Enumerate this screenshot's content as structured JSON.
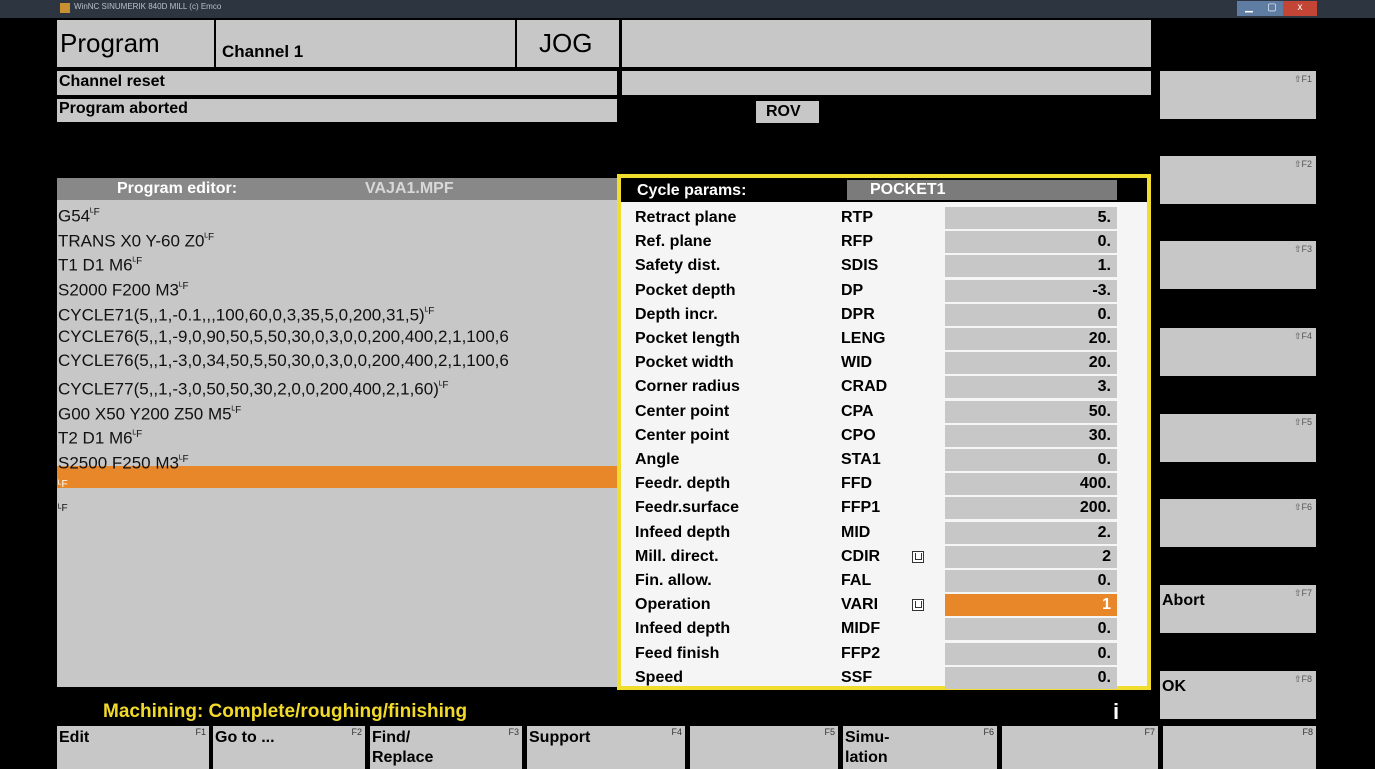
{
  "window": {
    "title": "WinNC SINUMERIK 840D MILL (c) Emco",
    "min_glyph": "▁",
    "max_glyph": "▢",
    "close_glyph": "x"
  },
  "header": {
    "area": "Program",
    "channel": "Channel 1",
    "mode": "JOG",
    "channel_status": "Channel reset",
    "program_status": "Program aborted",
    "rov": "ROV"
  },
  "editor": {
    "title": "Program editor:",
    "filename": "VAJA1.MPF",
    "lf_symbol": "ᴸF",
    "lines": [
      {
        "text": "G54",
        "lf": true
      },
      {
        "text": "TRANS X0 Y-60 Z0",
        "lf": true
      },
      {
        "text": "T1 D1 M6",
        "lf": true
      },
      {
        "text": "S2000 F200 M3",
        "lf": true
      },
      {
        "text": "CYCLE71(5,,1,-0.1,,,100,60,0,3,35,5,0,200,31,5)",
        "lf": true
      },
      {
        "text": "CYCLE76(5,,1,-9,0,90,50,5,50,30,0,3,0,0,200,400,2,1,100,6",
        "lf": false
      },
      {
        "text": "CYCLE76(5,,1,-3,0,34,50,5,50,30,0,3,0,0,200,400,2,1,100,6",
        "lf": false
      },
      {
        "text": "CYCLE77(5,,1,-3,0,50,50,30,2,0,0,200,400,2,1,60)",
        "lf": true
      },
      {
        "text": "G00 X50 Y200 Z50 M5",
        "lf": true
      },
      {
        "text": "T2 D1 M6",
        "lf": true
      },
      {
        "text": "S2500 F250 M3",
        "lf": true
      },
      {
        "text": "",
        "lf": true
      },
      {
        "text": "",
        "lf": true
      }
    ],
    "cursor_line_index": 11,
    "cursor_color": "#e8872a"
  },
  "cycle": {
    "title": "Cycle params:",
    "name": "POCKET1",
    "border_color": "#f1dd2e",
    "params": [
      {
        "label": "Retract plane",
        "name": "RTP",
        "value": "5."
      },
      {
        "label": "Ref. plane",
        "name": "RFP",
        "value": "0."
      },
      {
        "label": "Safety dist.",
        "name": "SDIS",
        "value": "1."
      },
      {
        "label": "Pocket depth",
        "name": "DP",
        "value": "-3."
      },
      {
        "label": "Depth incr.",
        "name": "DPR",
        "value": "0."
      },
      {
        "label": "Pocket length",
        "name": "LENG",
        "value": "20."
      },
      {
        "label": "Pocket width",
        "name": "WID",
        "value": "20."
      },
      {
        "label": "Corner radius",
        "name": "CRAD",
        "value": "3."
      },
      {
        "label": "Center point",
        "name": "CPA",
        "value": "50."
      },
      {
        "label": "Center point",
        "name": "CPO",
        "value": "30."
      },
      {
        "label": "Angle",
        "name": "STA1",
        "value": "0."
      },
      {
        "label": "Feedr. depth",
        "name": "FFD",
        "value": "400."
      },
      {
        "label": "Feedr.surface",
        "name": "FFP1",
        "value": "200."
      },
      {
        "label": "Infeed depth",
        "name": "MID",
        "value": "2."
      },
      {
        "label": "Mill. direct.",
        "name": "CDIR",
        "value": "2",
        "toggle": true
      },
      {
        "label": "Fin. allow.",
        "name": "FAL",
        "value": "0."
      },
      {
        "label": "Operation",
        "name": "VARI",
        "value": "1",
        "toggle": true,
        "selected": true
      },
      {
        "label": "Infeed depth",
        "name": "MIDF",
        "value": "0."
      },
      {
        "label": "Feed finish",
        "name": "FFP2",
        "value": "0."
      },
      {
        "label": "Speed",
        "name": "SSF",
        "value": "0."
      }
    ]
  },
  "vertical_softkeys": [
    {
      "key": "⇧F1",
      "label": ""
    },
    {
      "key": "⇧F2",
      "label": ""
    },
    {
      "key": "⇧F3",
      "label": ""
    },
    {
      "key": "⇧F4",
      "label": ""
    },
    {
      "key": "⇧F5",
      "label": ""
    },
    {
      "key": "⇧F6",
      "label": ""
    },
    {
      "key": "⇧F7",
      "label": "Abort"
    },
    {
      "key": "⇧F8",
      "label": "OK"
    }
  ],
  "message": "Machining: Complete/roughing/finishing",
  "info_glyph": "i",
  "horizontal_softkeys": [
    {
      "key": "F1",
      "line1": "Edit",
      "line2": ""
    },
    {
      "key": "F2",
      "line1": "Go to ...",
      "line2": ""
    },
    {
      "key": "F3",
      "line1": "Find/",
      "line2": "Replace"
    },
    {
      "key": "F4",
      "line1": "Support",
      "line2": ""
    },
    {
      "key": "F5",
      "line1": "",
      "line2": ""
    },
    {
      "key": "F6",
      "line1": "Simu-",
      "line2": "lation"
    },
    {
      "key": "F7",
      "line1": "",
      "line2": ""
    },
    {
      "key": "F8",
      "line1": "",
      "line2": ""
    }
  ]
}
